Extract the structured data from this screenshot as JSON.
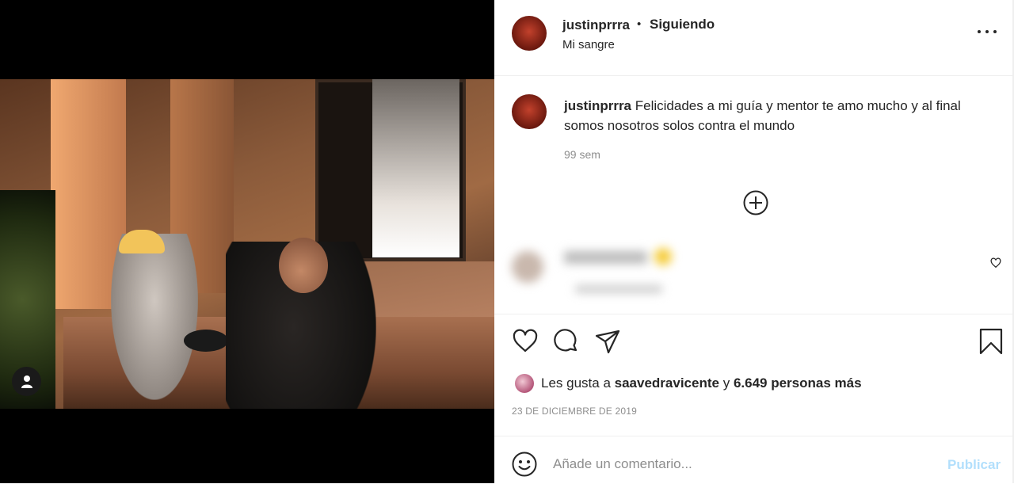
{
  "post": {
    "media": {
      "tag_icon": "user-tag-icon"
    },
    "header": {
      "username": "justinprrra",
      "separator": "•",
      "follow_status": "Siguiendo",
      "location": "Mi sangre",
      "more_icon": "more-options-icon"
    },
    "caption": {
      "username": "justinprrra",
      "text": "Felicidades a mi guía y mentor te amo mucho y al final somos nosotros solos contra el mundo",
      "time": "99 sem"
    },
    "load_more_icon": "plus-circle-icon",
    "actions": {
      "like_icon": "heart-icon",
      "comment_icon": "comment-bubble-icon",
      "share_icon": "paper-plane-icon",
      "save_icon": "bookmark-icon"
    },
    "likes": {
      "prefix": "Les gusta a",
      "user": "saavedravicente",
      "conjunction": "y",
      "others": "6.649 personas más"
    },
    "date": "23 DE DICIEMBRE DE 2019",
    "comment_box": {
      "emoji_icon": "smiley-icon",
      "placeholder": "Añade un comentario...",
      "submit_label": "Publicar"
    }
  },
  "colors": {
    "primary_text": "#262626",
    "secondary_text": "#8e8e8e",
    "publish_disabled": "#b2dffc",
    "divider": "#efefef"
  }
}
